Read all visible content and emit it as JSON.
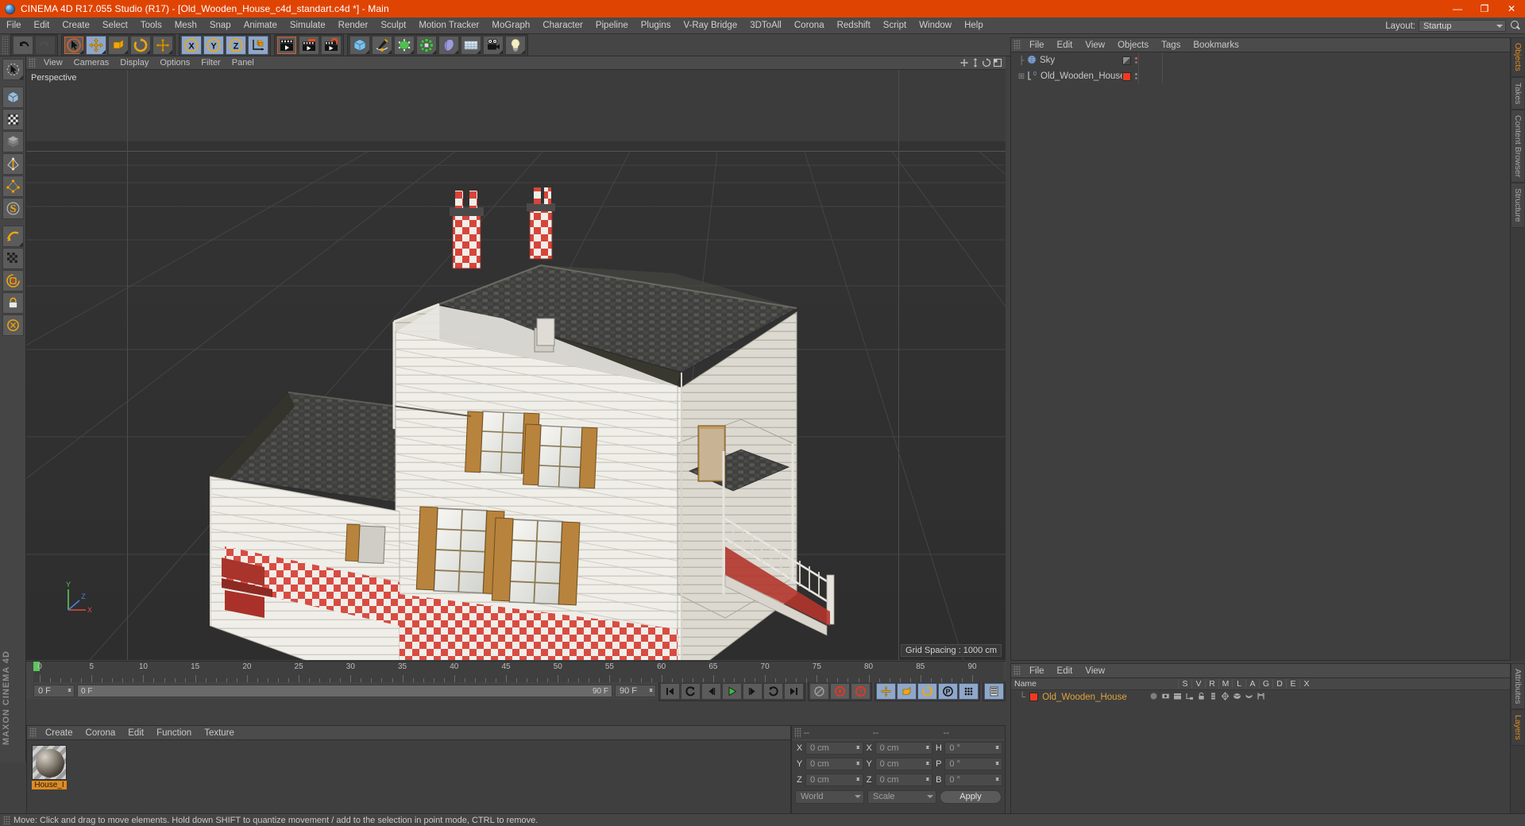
{
  "titlebar": {
    "app_title": "CINEMA 4D R17.055 Studio (R17) - [Old_Wooden_House_c4d_standart.c4d *] - Main",
    "minimize": "—",
    "maximize": "❐",
    "close": "✕",
    "accent_color": "#e04403"
  },
  "menubar": {
    "items": [
      "File",
      "Edit",
      "Create",
      "Select",
      "Tools",
      "Mesh",
      "Snap",
      "Animate",
      "Simulate",
      "Render",
      "Sculpt",
      "Motion Tracker",
      "MoGraph",
      "Character",
      "Pipeline",
      "Plugins",
      "V-Ray Bridge",
      "3DToAll",
      "Corona",
      "Redshift",
      "Script",
      "Window",
      "Help"
    ],
    "layout_label": "Layout:",
    "layout_value": "Startup",
    "search_icon": "search-icon"
  },
  "toolbar": {
    "groups": [
      {
        "name": "history",
        "buttons": [
          {
            "icon": "undo-icon",
            "state": "normal"
          },
          {
            "icon": "redo-icon",
            "state": "disabled"
          }
        ]
      },
      {
        "name": "transform",
        "buttons": [
          {
            "icon": "select-cursor-icon",
            "state": "highlight"
          },
          {
            "icon": "move-icon",
            "state": "selected"
          },
          {
            "icon": "scale-icon",
            "state": "normal"
          },
          {
            "icon": "rotate-icon",
            "state": "normal"
          },
          {
            "icon": "move-axis-icon",
            "state": "normal"
          }
        ]
      },
      {
        "name": "axis-locks",
        "buttons": [
          {
            "icon": "x-axis-icon",
            "state": "selected"
          },
          {
            "icon": "y-axis-icon",
            "state": "selected"
          },
          {
            "icon": "z-axis-icon",
            "state": "selected"
          },
          {
            "icon": "world-object-axis-icon",
            "state": "normal"
          }
        ]
      },
      {
        "name": "render",
        "buttons": [
          {
            "icon": "render-view-icon",
            "state": "highlight"
          },
          {
            "icon": "render-region-icon",
            "state": "normal"
          },
          {
            "icon": "render-settings-icon",
            "state": "normal"
          }
        ]
      },
      {
        "name": "objects",
        "buttons": [
          {
            "icon": "cube-primitive-icon",
            "state": "normal"
          },
          {
            "icon": "spline-pen-icon",
            "state": "normal"
          },
          {
            "icon": "nurbs-icon",
            "state": "normal"
          },
          {
            "icon": "array-icon",
            "state": "normal"
          },
          {
            "icon": "deformer-icon",
            "state": "normal"
          },
          {
            "icon": "floor-environment-icon",
            "state": "normal"
          },
          {
            "icon": "camera-icon",
            "state": "normal"
          },
          {
            "icon": "light-icon",
            "state": "normal"
          }
        ]
      }
    ]
  },
  "left_palette": {
    "buttons": [
      {
        "icon": "live-selection-icon"
      },
      {
        "icon": "model-mode-icon"
      },
      {
        "icon": "texture-mode-icon"
      },
      {
        "icon": "polygon-mode-icon"
      },
      {
        "icon": "edge-mode-icon"
      },
      {
        "icon": "point-mode-icon"
      },
      {
        "icon": "object-axis-mode-icon"
      },
      {
        "icon": "workplane-icon"
      },
      {
        "icon": "enable-axis-icon"
      },
      {
        "icon": "snap-icon"
      },
      {
        "icon": "quantize-icon"
      },
      {
        "icon": "viewport-solo-icon"
      },
      {
        "icon": "lock-icon"
      },
      {
        "icon": "parametric-icon"
      }
    ],
    "brand": "MAXON CINEMA 4D"
  },
  "viewport": {
    "menu": [
      "View",
      "Cameras",
      "Display",
      "Options",
      "Filter",
      "Panel"
    ],
    "view_label": "Perspective",
    "grid_spacing": "Grid Spacing : 1000 cm",
    "axis_labels": {
      "x": "X",
      "y": "Y",
      "z": "Z"
    },
    "nav_icons": [
      "move-view-icon",
      "scale-view-icon",
      "rotate-view-icon",
      "maximize-view-icon"
    ]
  },
  "object_manager": {
    "menu": [
      "File",
      "Edit",
      "View",
      "Objects",
      "Tags",
      "Bookmarks"
    ],
    "objects": [
      {
        "name": "Sky",
        "icon": "sky-object-icon",
        "tag_color": "#7f7f7f",
        "expandable": false,
        "selected": false
      },
      {
        "name": "Old_Wooden_House",
        "icon": "null-object-icon",
        "tag_color": "#f2391f",
        "expandable": true,
        "selected": false
      }
    ]
  },
  "timeline": {
    "ruler_labels": [
      "0",
      "5",
      "10",
      "15",
      "20",
      "25",
      "30",
      "35",
      "40",
      "45",
      "50",
      "55",
      "60",
      "65",
      "70",
      "75",
      "80",
      "85",
      "90"
    ],
    "range_start": 0,
    "range_end": 90,
    "end_field": "0 F",
    "current_frame_field": "0 F",
    "scrub_left": "0 F",
    "scrub_right": "90 F",
    "frame_end_field": "90 F",
    "transport": [
      {
        "icon": "go-to-start-icon",
        "state": "normal"
      },
      {
        "icon": "previous-key-icon",
        "state": "normal"
      },
      {
        "icon": "step-back-icon",
        "state": "normal"
      },
      {
        "icon": "play-icon",
        "state": "normal"
      },
      {
        "icon": "step-forward-icon",
        "state": "normal"
      },
      {
        "icon": "next-key-icon",
        "state": "normal"
      },
      {
        "icon": "go-to-end-icon",
        "state": "normal"
      }
    ],
    "record_group": [
      {
        "icon": "autokey-icon",
        "state": "normal"
      },
      {
        "icon": "record-active-objects-icon",
        "state": "normal"
      },
      {
        "icon": "auto-keyframing-icon",
        "state": "normal"
      }
    ],
    "key_group": [
      {
        "icon": "key-position-icon",
        "state": "selected"
      },
      {
        "icon": "key-scale-icon",
        "state": "selected"
      },
      {
        "icon": "key-rotation-icon",
        "state": "selected"
      },
      {
        "icon": "key-parameter-icon",
        "state": "selected"
      },
      {
        "icon": "key-point-level-icon",
        "state": "selected"
      }
    ],
    "extra_group": [
      {
        "icon": "timeline-icon",
        "state": "selected"
      }
    ]
  },
  "material_manager": {
    "menu": [
      "Create",
      "Corona",
      "Edit",
      "Function",
      "Texture"
    ],
    "materials": [
      {
        "name": "House_I",
        "thumb": "sphere-preview"
      }
    ]
  },
  "coordinates": {
    "headers": [
      "--",
      "--",
      "--"
    ],
    "rows": [
      {
        "label_pos": "X",
        "value_pos": "0 cm",
        "label_size": "X",
        "value_size": "0 cm",
        "label_rot": "H",
        "value_rot": "0 °"
      },
      {
        "label_pos": "Y",
        "value_pos": "0 cm",
        "label_size": "Y",
        "value_size": "0 cm",
        "label_rot": "P",
        "value_rot": "0 °"
      },
      {
        "label_pos": "Z",
        "value_pos": "0 cm",
        "label_size": "Z",
        "value_size": "0 cm",
        "label_rot": "B",
        "value_rot": "0 °"
      }
    ],
    "system": "World",
    "mode": "Scale",
    "apply": "Apply"
  },
  "attribute_manager": {
    "menu": [
      "File",
      "Edit",
      "View"
    ],
    "columns": [
      "Name",
      "S",
      "V",
      "R",
      "M",
      "L",
      "A",
      "G",
      "D",
      "E",
      "X"
    ],
    "rows": [
      {
        "name": "Old_Wooden_House",
        "color": "#f2391f"
      }
    ]
  },
  "right_tabs_top": [
    "Objects",
    "Takes",
    "Content Browser",
    "Structure"
  ],
  "right_tabs_bottom": [
    "Attributes",
    "Layers"
  ],
  "statusbar": {
    "message": "Move: Click and drag to move elements. Hold down SHIFT to quantize movement / add to the selection in point mode, CTRL to remove."
  }
}
